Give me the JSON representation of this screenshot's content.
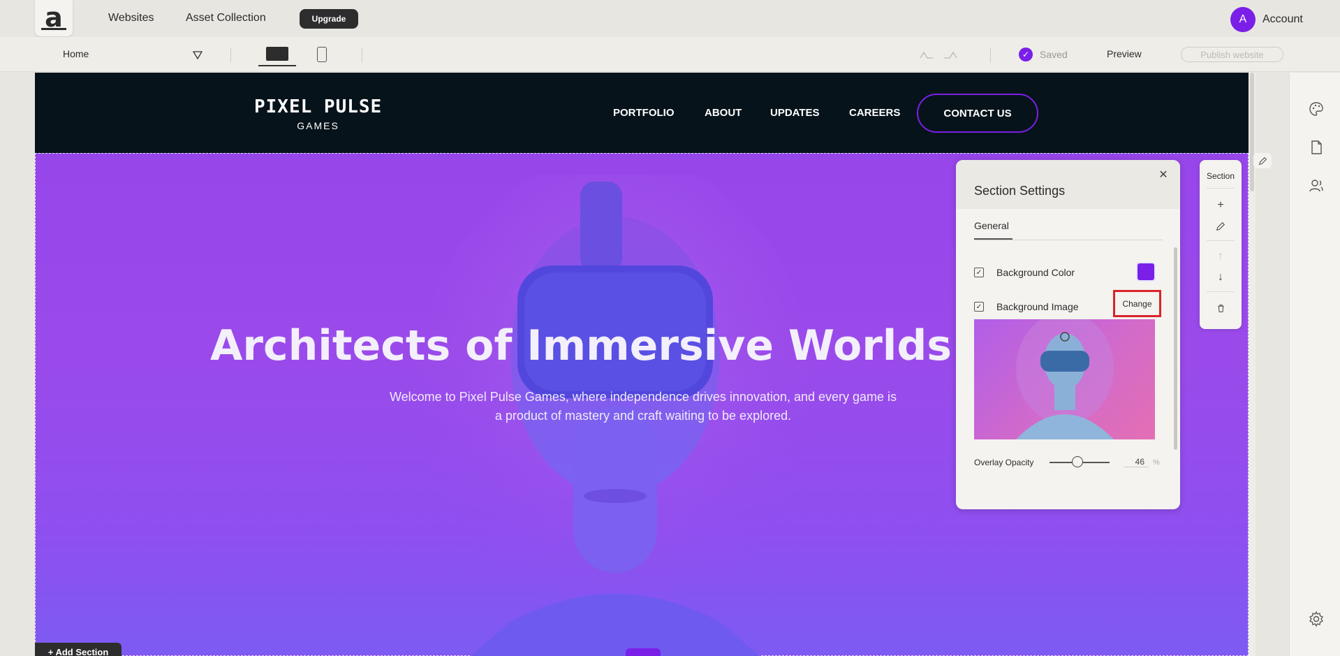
{
  "appbar": {
    "logo": "a",
    "nav": [
      "Websites",
      "Asset Collection"
    ],
    "upgrade": "Upgrade",
    "avatar_initial": "A",
    "account": "Account"
  },
  "toolbar": {
    "page": "Home",
    "saved": "Saved",
    "preview": "Preview",
    "publish": "Publish website"
  },
  "site": {
    "brand_name": "PIXEL PULSE",
    "brand_sub": "GAMES",
    "nav": [
      "PORTFOLIO",
      "ABOUT",
      "UPDATES",
      "CAREERS"
    ],
    "contact": "CONTACT US",
    "hero_title": "Architects of Immersive Worlds",
    "hero_sub": "Welcome to Pixel Pulse Games, where independence drives innovation, and every game is a product of mastery and craft waiting to be explored.",
    "add_section": "+ Add Section"
  },
  "panel": {
    "title": "Section Settings",
    "tab": "General",
    "bg_color_label": "Background Color",
    "bg_color": "#7a1fe8",
    "bg_image_label": "Background Image",
    "change": "Change",
    "overlay_label": "Overlay Opacity",
    "overlay_value": "46",
    "overlay_unit": "%"
  },
  "section_tools": {
    "label": "Section"
  }
}
